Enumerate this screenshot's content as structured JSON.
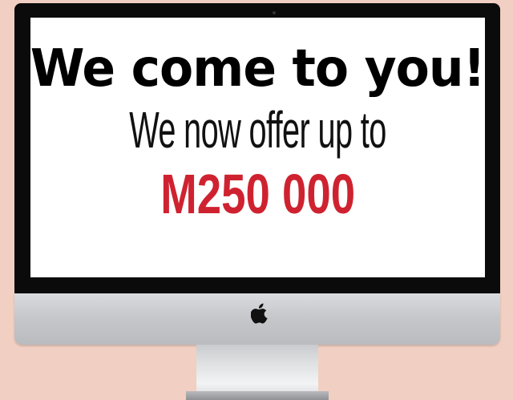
{
  "ad": {
    "headline": "We come to you!",
    "subline": "We now offer up to",
    "amount": "M250 000"
  },
  "colors": {
    "background": "#f1cfc2",
    "amount": "#cf2230",
    "bezel": "#0b0b0b"
  },
  "icons": {
    "logo": "apple-logo-icon"
  }
}
